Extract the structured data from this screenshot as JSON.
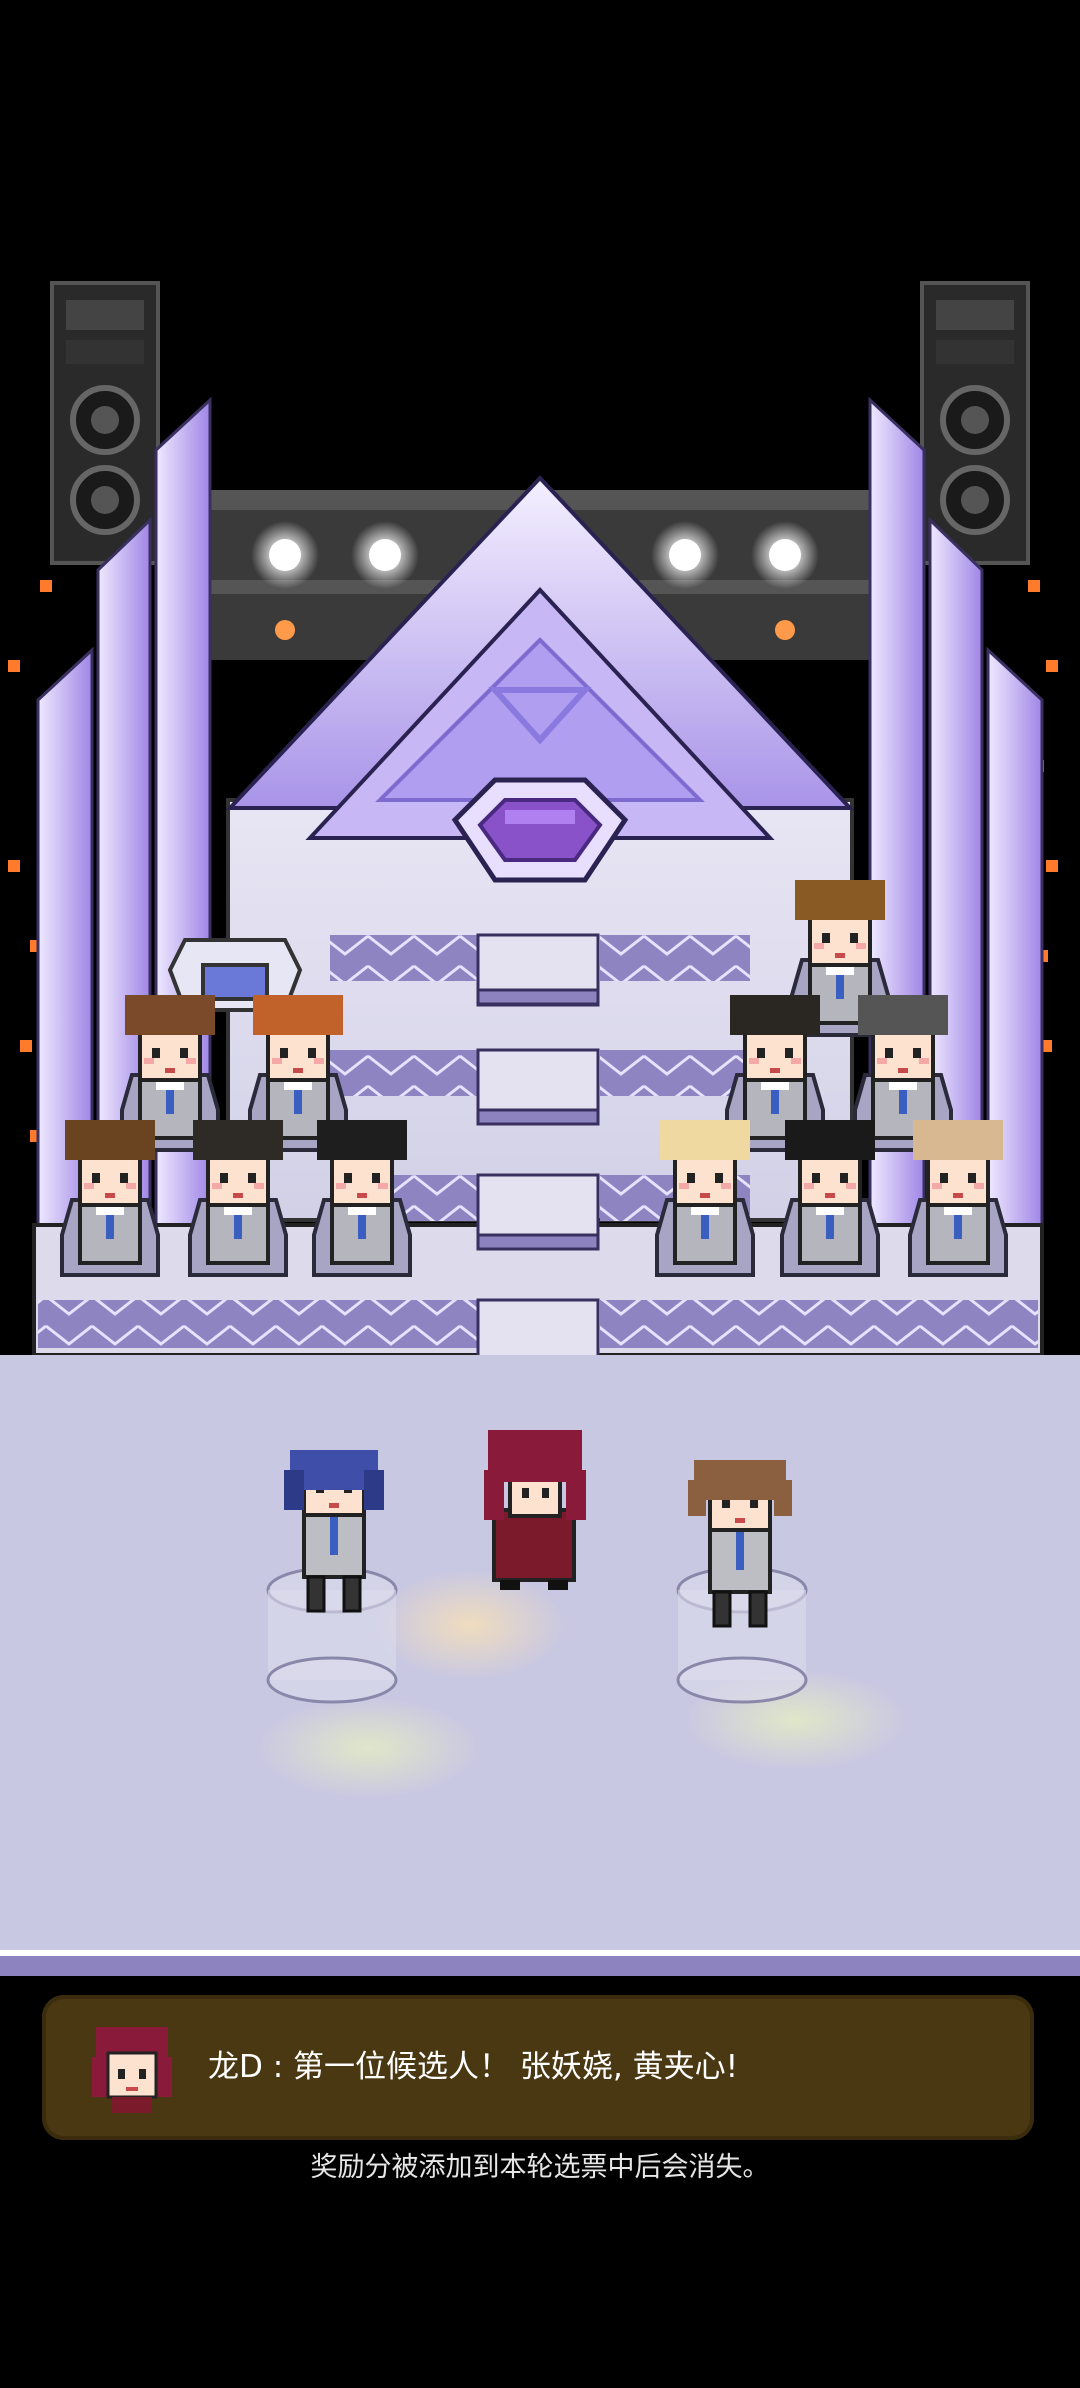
{
  "dialog": {
    "speaker": "龙D",
    "separator": " : ",
    "message": "第一位候选人！ 张妖娆, 黄夹心!"
  },
  "hint": "奖励分被添加到本轮选票中后会消失。",
  "colors": {
    "background": "#000000",
    "stage_floor": "#c9c8e2",
    "stage_trim": "#8c83bf",
    "dialog_bg": "#4a3812",
    "crown_light": "#d9d2ff",
    "crown_mid": "#a995ea",
    "gem": "#8a52c9"
  },
  "icons": {
    "dialog_avatar": "host-portrait-icon",
    "center_gem": "gem-icon"
  }
}
